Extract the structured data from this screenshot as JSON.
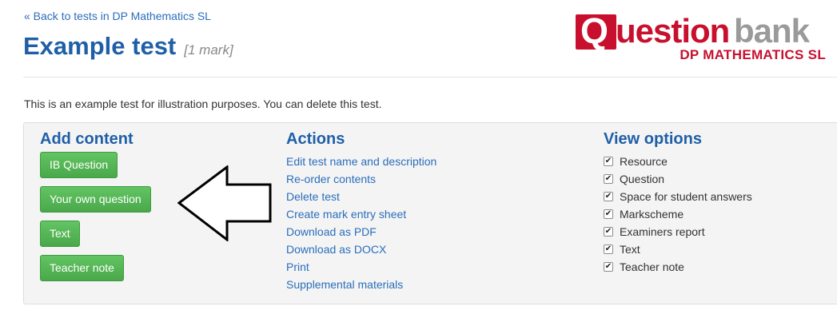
{
  "header": {
    "back_link": "« Back to tests in DP Mathematics SL",
    "title": "Example test",
    "marks": "[1 mark]"
  },
  "logo": {
    "letter": "Q",
    "word_red": "uestion",
    "word_grey": "bank",
    "subtitle": "DP MATHEMATICS SL"
  },
  "description": "This is an example test for illustration purposes. You can delete this test.",
  "add_content": {
    "heading": "Add content",
    "buttons": [
      "IB Question",
      "Your own question",
      "Text",
      "Teacher note"
    ]
  },
  "actions": {
    "heading": "Actions",
    "links": [
      "Edit test name and description",
      "Re-order contents",
      "Delete test",
      "Create mark entry sheet",
      "Download as PDF",
      "Download as DOCX",
      "Print",
      "Supplemental materials"
    ]
  },
  "view_options": {
    "heading": "View options",
    "items": [
      {
        "label": "Resource",
        "checked": true
      },
      {
        "label": "Question",
        "checked": true
      },
      {
        "label": "Space for student answers",
        "checked": true
      },
      {
        "label": "Markscheme",
        "checked": true
      },
      {
        "label": "Examiners report",
        "checked": true
      },
      {
        "label": "Text",
        "checked": true
      },
      {
        "label": "Teacher note",
        "checked": true
      }
    ]
  },
  "colors": {
    "title_blue": "#1f5fa8",
    "link_blue": "#2a6ebb",
    "brand_red": "#c8102e",
    "button_green": "#5cb85c"
  }
}
